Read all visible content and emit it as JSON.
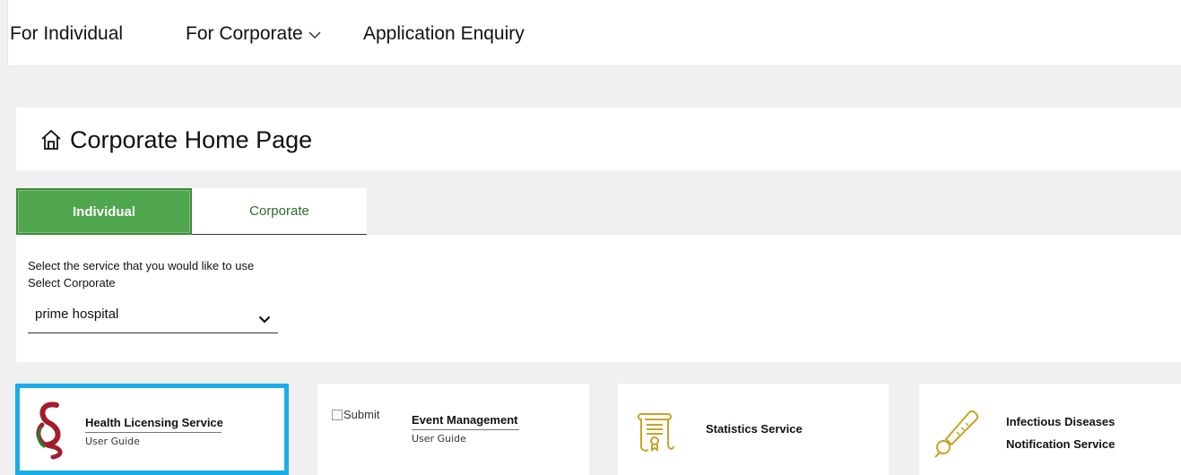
{
  "nav": {
    "individual": "For Individual",
    "corporate": "For Corporate",
    "enquiry": "Application Enquiry"
  },
  "page": {
    "title": "Corporate Home Page"
  },
  "tabs": {
    "individual": "Individual",
    "corporate": "Corporate"
  },
  "service_select": {
    "prompt": "Select the service that you would like to use",
    "label": "Select Corporate",
    "selected": "prime hospital"
  },
  "cards": [
    {
      "title": "Health Licensing Service",
      "guide": "User Guide"
    },
    {
      "alt": "Submit",
      "title": "Event Management",
      "guide": "User Guide"
    },
    {
      "title": "Statistics Service"
    },
    {
      "title_line1": "Infectious Diseases",
      "title_line2": "Notification Service"
    }
  ],
  "colors": {
    "active_tab": "#4fa64d",
    "selected_card_border": "#1aaee8",
    "icon_gold": "#c9a227",
    "logo_red": "#a31d2c",
    "logo_green": "#2e7d32"
  }
}
